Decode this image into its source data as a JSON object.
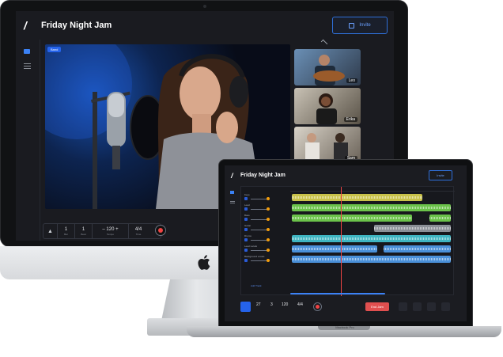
{
  "app": {
    "name": "Friday Night Jam",
    "invite_label": "Invite",
    "live_badge": "Band",
    "participants": [
      "Leo",
      "Erika",
      "Sam"
    ]
  },
  "controls": {
    "count_in": "1",
    "bar": "1",
    "tempo": "120",
    "time_signature": "4/4",
    "bar_label": "Bar",
    "beat_label": "Beat",
    "tempo_label": "Tempo",
    "time_label": "Time"
  },
  "macbook": {
    "label": "Macbook Pro",
    "end_jam_label": "End Jam",
    "add_track_label": "Add Track",
    "bpm_value": "27",
    "beats": "3",
    "tempo": "120",
    "time_signature": "4/4",
    "tracks": [
      "Keys",
      "Lead",
      "Bass",
      "Guitar",
      "Drums",
      "Lead vocals",
      "Background vocals"
    ]
  },
  "colors": {
    "accent": "#2563eb",
    "record": "#ef4444",
    "end_jam": "#e04f4f",
    "track_yellow": "#c9c24a",
    "track_green": "#6bc24a",
    "track_grey": "#8a8f96",
    "track_teal": "#3fb5c2",
    "track_blue": "#4a90d9"
  }
}
